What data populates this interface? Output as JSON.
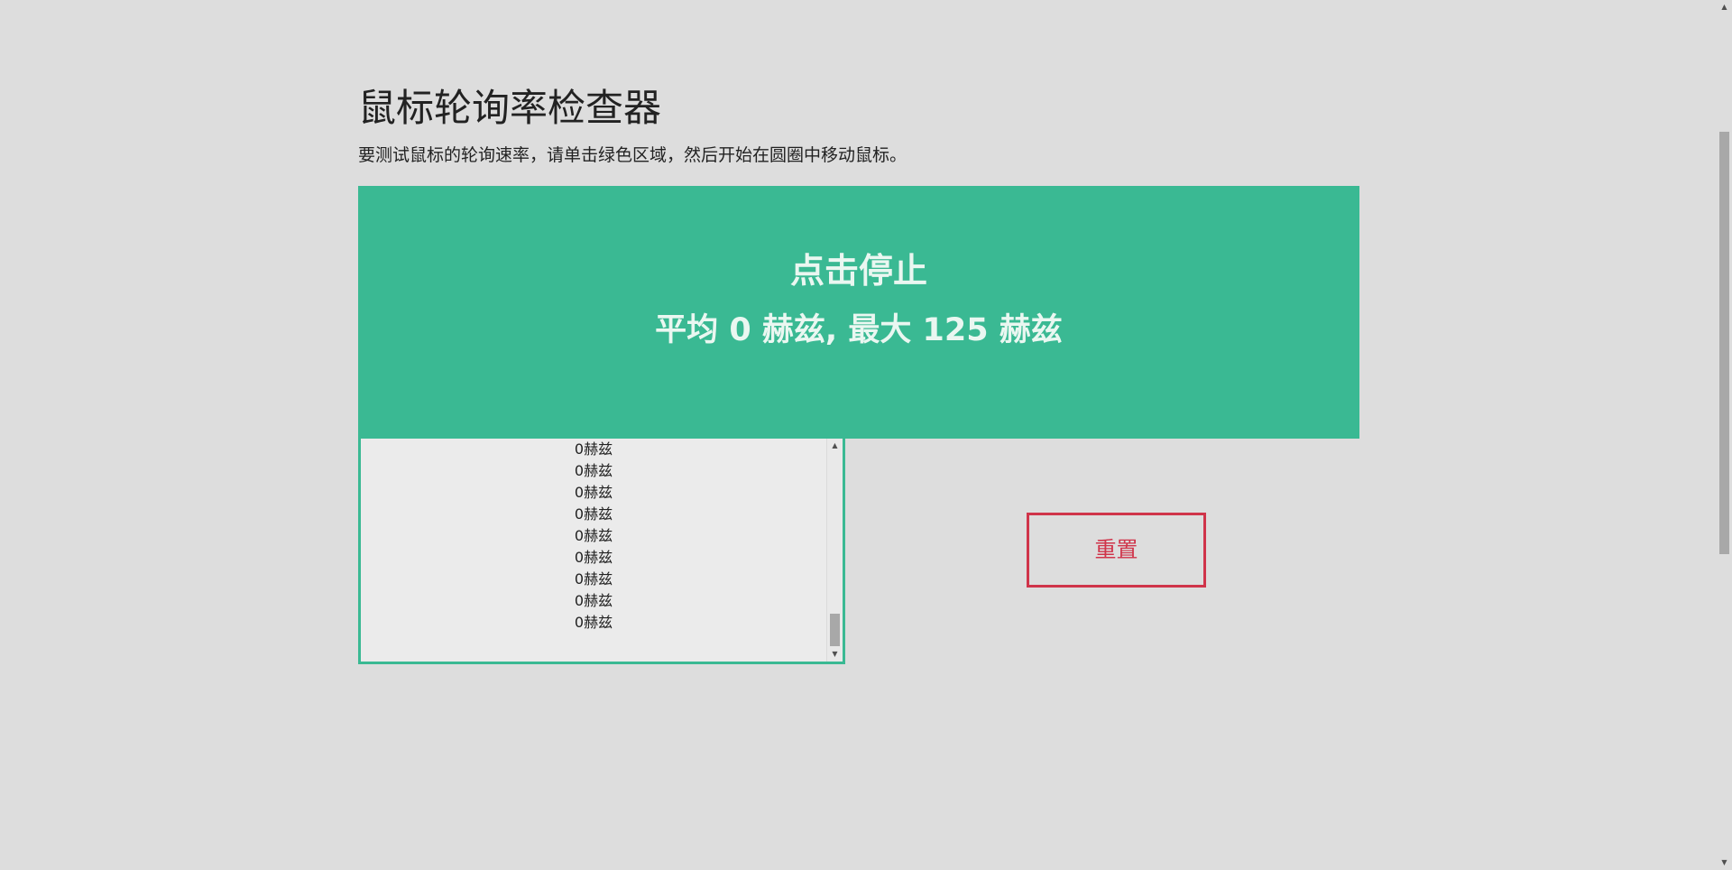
{
  "page": {
    "title": "鼠标轮询率检查器",
    "instructions": "要测试鼠标的轮询速率，请单击绿色区域，然后开始在圆圈中移动鼠标。"
  },
  "test_area": {
    "action_text": "点击停止",
    "stats_text": "平均 0 赫兹, 最大 125 赫兹",
    "color": "#3ab993"
  },
  "log": {
    "entries": [
      "0赫兹",
      "0赫兹",
      "0赫兹",
      "0赫兹",
      "0赫兹",
      "0赫兹",
      "0赫兹",
      "0赫兹",
      "0赫兹"
    ],
    "scroll_up_icon": "triangle-up",
    "scroll_down_icon": "triangle-down"
  },
  "reset": {
    "label": "重置",
    "color": "#d0344a"
  }
}
